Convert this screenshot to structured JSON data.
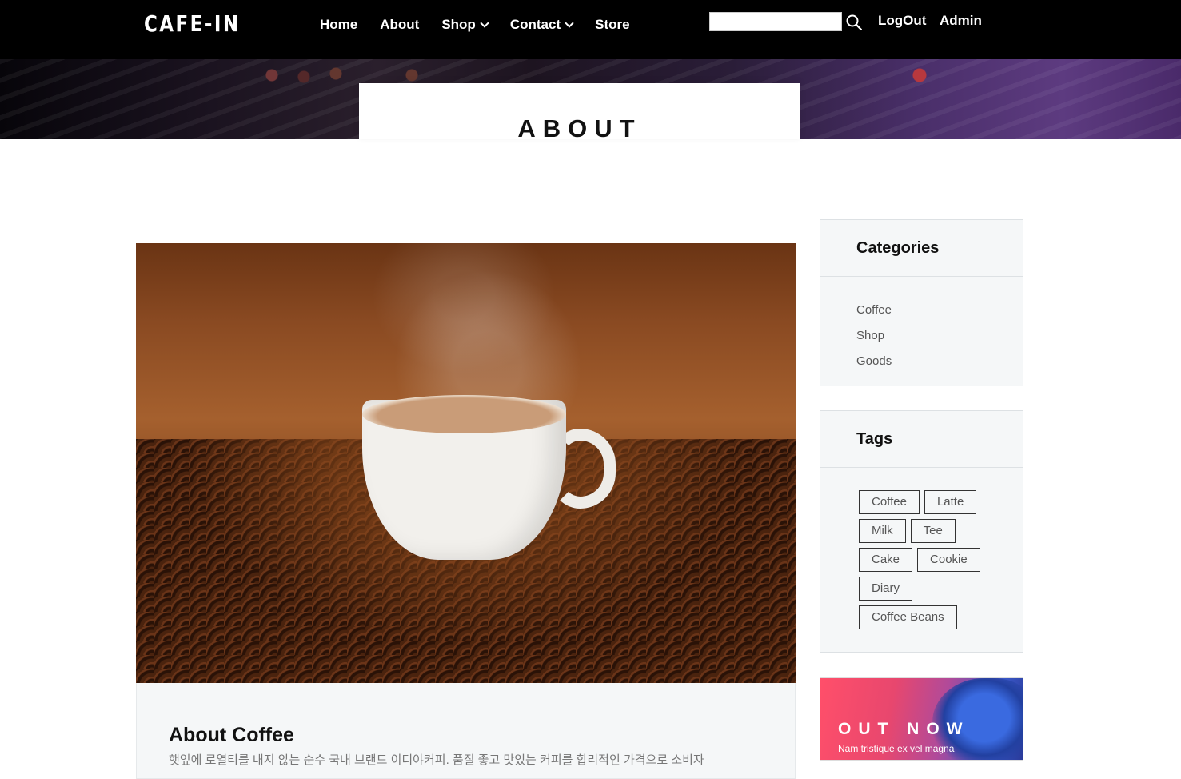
{
  "header": {
    "logo": "CAFE-IN",
    "nav": [
      {
        "label": "Home",
        "dropdown": false
      },
      {
        "label": "About",
        "dropdown": false
      },
      {
        "label": "Shop",
        "dropdown": true
      },
      {
        "label": "Contact",
        "dropdown": true
      },
      {
        "label": "Store",
        "dropdown": false
      }
    ],
    "search": {
      "value": "",
      "placeholder": ""
    },
    "logout": "LogOut",
    "admin": "Admin"
  },
  "hero": {
    "title": "ABOUT"
  },
  "article": {
    "title": "About Coffee",
    "excerpt": "햇잎에 로열티를 내지 않는 순수 국내 브랜드 이디야커피. 품질 좋고 맛있는 커피를 합리적인 가격으로 소비자"
  },
  "sidebar": {
    "categories": {
      "title": "Categories",
      "items": [
        "Coffee",
        "Shop",
        "Goods"
      ]
    },
    "tags": {
      "title": "Tags",
      "items": [
        "Coffee",
        "Latte",
        "Milk",
        "Tee",
        "Cake",
        "Cookie",
        "Diary",
        "Coffee Beans"
      ]
    },
    "promo": {
      "title": "OUT NOW",
      "subtitle": "Nam tristique ex vel magna"
    }
  },
  "colors": {
    "navbar": "#000000",
    "widget_bg": "#f5f7f8",
    "text_dark": "#111111"
  }
}
